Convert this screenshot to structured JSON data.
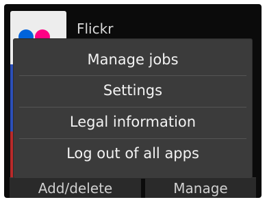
{
  "app": {
    "name": "Flickr",
    "icon": "flickr-logo-icon"
  },
  "bottom_bar": {
    "left_button": "Add/delete",
    "right_button": "Manage"
  },
  "menu": {
    "items": [
      {
        "label": "Manage jobs"
      },
      {
        "label": "Settings"
      },
      {
        "label": "Legal information"
      },
      {
        "label": "Log out of all apps"
      }
    ]
  },
  "colors": {
    "screen_bg": "#0b0b0b",
    "menu_bg": "#3b3b3b",
    "menu_text": "#f3f3f3",
    "flickr_blue": "#0063dc",
    "flickr_pink": "#ff0084"
  }
}
